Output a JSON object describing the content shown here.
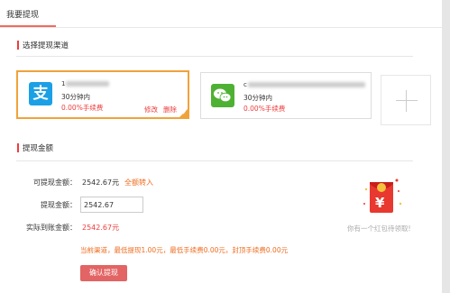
{
  "header": {
    "tab_label": "我要提现"
  },
  "channels_section": {
    "title": "选择提现渠道"
  },
  "channels": [
    {
      "account": "1",
      "time": "30分钟内",
      "fee": "0.00%手续费",
      "edit_label": "修改",
      "delete_label": "删除",
      "logo_char": "支",
      "color": "#1ba0e6",
      "selected": true
    },
    {
      "account": "c",
      "time": "30分钟内",
      "fee": "0.00%手续费",
      "color": "#4fb133",
      "selected": false
    }
  ],
  "amount_section": {
    "title": "提现金额",
    "available_label": "可提现金额：",
    "available_value": "2542.67元",
    "withdraw_all_label": "全额转入",
    "amount_label": "提现金额：",
    "amount_value": "2542.67",
    "actual_label": "实际到账金额：",
    "actual_value": "2542.67元",
    "notice": "当前渠道，最低提现1.00元，最低手续费0.00元，封顶手续费0.00元",
    "confirm_label": "确认提现"
  },
  "promo": {
    "text": "你有一个红包待领取!",
    "symbol": "¥"
  },
  "colors": {
    "accent": "#ee3d3d",
    "orange": "#f0a23a",
    "alipay": "#1ba0e6",
    "wechat": "#4fb133"
  }
}
